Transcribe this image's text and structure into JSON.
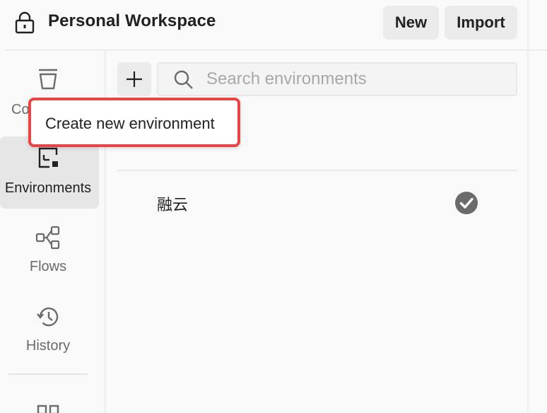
{
  "header": {
    "title": "Personal Workspace",
    "new_label": "New",
    "import_label": "Import",
    "icon": "lock-icon"
  },
  "sidebar": {
    "items": [
      {
        "label": "Co",
        "icon": "trash-icon",
        "active": false
      },
      {
        "label": "Environments",
        "icon": "environment-icon",
        "active": true
      },
      {
        "label": "Flows",
        "icon": "flows-icon",
        "active": false
      },
      {
        "label": "History",
        "icon": "history-icon",
        "active": false
      }
    ]
  },
  "main": {
    "search": {
      "placeholder": "Search environments",
      "value": ""
    },
    "environments": [
      {
        "name": "融云",
        "active": true
      }
    ]
  },
  "tooltip": {
    "text": "Create new environment"
  },
  "colors": {
    "accent_border": "#e84545",
    "active_bg": "#e6e6e6",
    "button_bg": "#ebebeb",
    "check_bg": "#6b6b6b"
  }
}
